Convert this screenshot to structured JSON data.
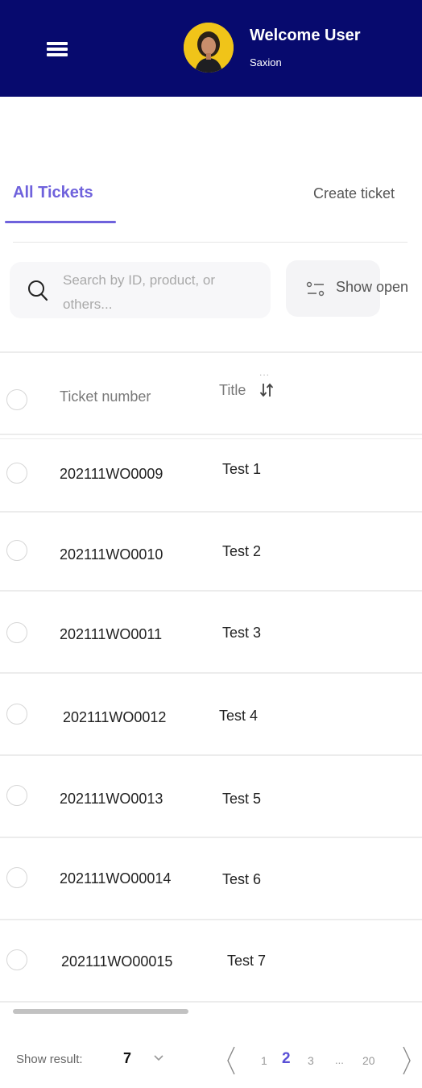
{
  "header": {
    "welcome": "Welcome User",
    "organization": "Saxion",
    "bg_color": "#070a6e"
  },
  "tabs": {
    "all_tickets": "All Tickets",
    "create_ticket": "Create ticket",
    "accent_color": "#6f62dc"
  },
  "search": {
    "placeholder": "Search by ID, product, or others..."
  },
  "filter": {
    "label": "Show open",
    "icon": "sliders-icon"
  },
  "table": {
    "columns": {
      "ticket_number": "Ticket number",
      "title": "Title",
      "title_sort_icon": "sort-arrows-icon",
      "title_dots": "..."
    },
    "rows": [
      {
        "ticket_number": "202111WO0009",
        "title": "Test 1"
      },
      {
        "ticket_number": "202111WO0010",
        "title": "Test 2"
      },
      {
        "ticket_number": "202111WO0011",
        "title": "Test 3"
      },
      {
        "ticket_number": "202111WO0012",
        "title": "Test 4"
      },
      {
        "ticket_number": "202111WO0013",
        "title": "Test 5"
      },
      {
        "ticket_number": "202111WO00014",
        "title": "Test 6"
      },
      {
        "ticket_number": "202111WO00015",
        "title": "Test 7"
      }
    ]
  },
  "footer": {
    "show_result_label": "Show result:",
    "show_result_value": "7",
    "pages": [
      "1",
      "2",
      "3"
    ],
    "active_page": "2",
    "ellipsis": "...",
    "last_page": "20"
  }
}
